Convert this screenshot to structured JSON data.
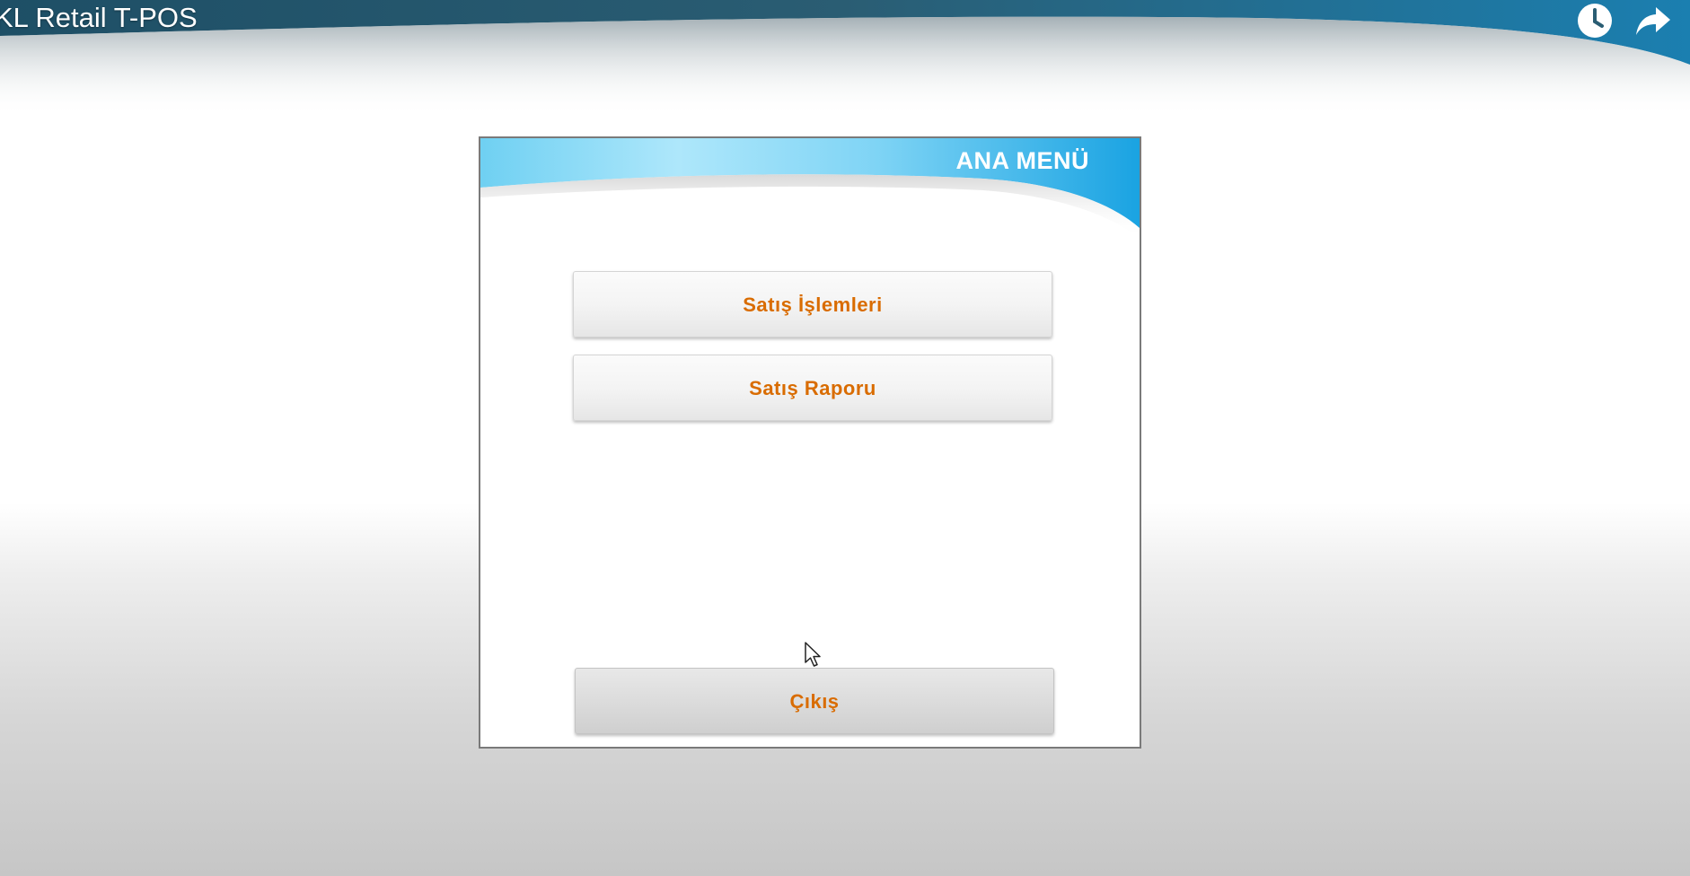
{
  "video": {
    "title": "KL Retail T-POS",
    "icons": [
      "clock-icon",
      "share-icon"
    ]
  },
  "window": {
    "title": "ANA MENÜ",
    "accent_color": "#2aa7e0"
  },
  "menu": {
    "items": [
      {
        "label": "Satış İşlemleri"
      },
      {
        "label": "Satış Raporu"
      }
    ],
    "exit_label": "Çıkış",
    "label_color": "#d96c00"
  }
}
